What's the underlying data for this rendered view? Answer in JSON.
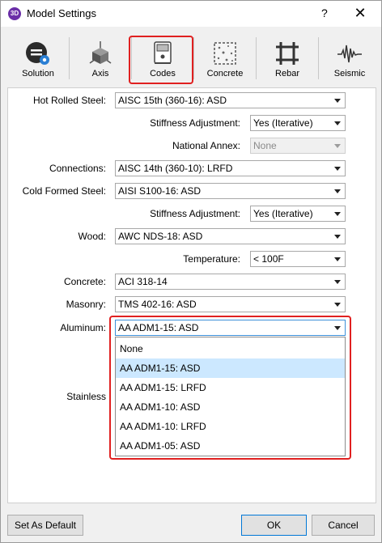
{
  "window": {
    "title": "Model Settings",
    "icon_text": "3D",
    "help_glyph": "?",
    "close_glyph": "✕"
  },
  "toolbar": {
    "items": [
      {
        "label": "Solution",
        "icon": "solution-icon"
      },
      {
        "label": "Axis",
        "icon": "axis-icon"
      },
      {
        "label": "Codes",
        "icon": "codes-icon",
        "active": true
      },
      {
        "label": "Concrete",
        "icon": "concrete-icon"
      },
      {
        "label": "Rebar",
        "icon": "rebar-icon"
      },
      {
        "label": "Seismic",
        "icon": "seismic-icon"
      }
    ]
  },
  "codes": {
    "hot_rolled_steel": {
      "label": "Hot Rolled Steel:",
      "value": "AISC 15th (360-16): ASD"
    },
    "stiffness_adjustment_1": {
      "label": "Stiffness Adjustment:",
      "value": "Yes (Iterative)"
    },
    "national_annex": {
      "label": "National Annex:",
      "value": "None",
      "disabled": true
    },
    "connections": {
      "label": "Connections:",
      "value": "AISC 14th (360-10): LRFD"
    },
    "cold_formed_steel": {
      "label": "Cold Formed Steel:",
      "value": "AISI S100-16: ASD"
    },
    "stiffness_adjustment_2": {
      "label": "Stiffness Adjustment:",
      "value": "Yes (Iterative)"
    },
    "wood": {
      "label": "Wood:",
      "value": "AWC NDS-18: ASD"
    },
    "temperature": {
      "label": "Temperature:",
      "value": "< 100F"
    },
    "concrete": {
      "label": "Concrete:",
      "value": "ACI 318-14"
    },
    "masonry": {
      "label": "Masonry:",
      "value": "TMS 402-16: ASD"
    },
    "aluminum": {
      "label": "Aluminum:",
      "value": "AA ADM1-15: ASD",
      "options": [
        "None",
        "AA ADM1-15: ASD",
        "AA ADM1-15: LRFD",
        "AA ADM1-10: ASD",
        "AA ADM1-10: LRFD",
        "AA ADM1-05: ASD"
      ],
      "highlighted": "AA ADM1-15: ASD"
    },
    "stainless": {
      "label": "Stainless"
    }
  },
  "footer": {
    "set_default": "Set As Default",
    "ok": "OK",
    "cancel": "Cancel"
  },
  "colors": {
    "highlight_border": "#e02020",
    "selected_option": "#cce8ff",
    "focus": "#3c8fd8"
  }
}
